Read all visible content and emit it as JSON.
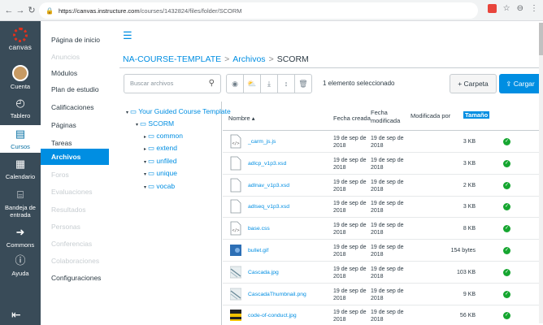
{
  "browser": {
    "url_host": "https://canvas.instructure.com",
    "url_path": "/courses/1432824/files/folder/SCORM"
  },
  "global_nav": {
    "logo": "canvas",
    "items": [
      {
        "label": "Cuenta",
        "icon": "user-avatar"
      },
      {
        "label": "Tablero",
        "icon": "dashboard-icon"
      },
      {
        "label": "Cursos",
        "icon": "courses-icon"
      },
      {
        "label": "Calendario",
        "icon": "calendar-icon"
      },
      {
        "label": "Bandeja de entrada",
        "icon": "inbox-icon"
      },
      {
        "label": "Commons",
        "icon": "commons-icon"
      },
      {
        "label": "Ayuda",
        "icon": "help-icon"
      }
    ]
  },
  "course_nav": [
    {
      "label": "Página de inicio",
      "state": "normal"
    },
    {
      "label": "Anuncios",
      "state": "disabled"
    },
    {
      "label": "Módulos",
      "state": "normal"
    },
    {
      "label": "Plan de estudio",
      "state": "normal"
    },
    {
      "label": "Calificaciones",
      "state": "normal"
    },
    {
      "label": "Páginas",
      "state": "normal"
    },
    {
      "label": "Tareas",
      "state": "normal"
    },
    {
      "label": "Archivos",
      "state": "active"
    },
    {
      "label": "Foros",
      "state": "disabled"
    },
    {
      "label": "Evaluaciones",
      "state": "disabled"
    },
    {
      "label": "Resultados",
      "state": "disabled"
    },
    {
      "label": "Personas",
      "state": "disabled"
    },
    {
      "label": "Conferencias",
      "state": "disabled"
    },
    {
      "label": "Colaboraciones",
      "state": "disabled"
    },
    {
      "label": "Configuraciones",
      "state": "normal"
    }
  ],
  "breadcrumb": {
    "course": "NA-COURSE-TEMPLATE",
    "section": "Archivos",
    "current": "SCORM",
    "separator": ">"
  },
  "toolbar": {
    "search_placeholder": "Buscar archivos",
    "selected_text": "1 elemento seleccionado",
    "folder_button": "Carpeta",
    "upload_button": "Cargar"
  },
  "tree": [
    {
      "label": "Your Guided Course Template",
      "level": 0,
      "expanded": true
    },
    {
      "label": "SCORM",
      "level": 1,
      "expanded": true
    },
    {
      "label": "common",
      "level": 2,
      "expanded": false
    },
    {
      "label": "extend",
      "level": 2,
      "expanded": false
    },
    {
      "label": "unfiled",
      "level": 2,
      "expanded": true
    },
    {
      "label": "unique",
      "level": 2,
      "expanded": true
    },
    {
      "label": "vocab",
      "level": 2,
      "expanded": true
    }
  ],
  "table": {
    "headers": {
      "name": "Nombre",
      "created": "Fecha creada",
      "modified_l1": "Fecha",
      "modified_l2": "modificada",
      "modified_by": "Modificada por",
      "size": "Tamaño"
    },
    "rows": [
      {
        "name": "_carm_js.js",
        "icon": "code",
        "created_l1": "19 de sep de",
        "created_l2": "2018",
        "modified_l1": "19 de sep de",
        "modified_l2": "2018",
        "size": "3 KB"
      },
      {
        "name": "adlcp_v1p3.xsd",
        "icon": "doc",
        "created_l1": "19 de sep de",
        "created_l2": "2018",
        "modified_l1": "19 de sep de",
        "modified_l2": "2018",
        "size": "3 KB"
      },
      {
        "name": "adlnav_v1p3.xsd",
        "icon": "doc",
        "created_l1": "19 de sep de",
        "created_l2": "2018",
        "modified_l1": "19 de sep de",
        "modified_l2": "2018",
        "size": "2 KB"
      },
      {
        "name": "adlseq_v1p3.xsd",
        "icon": "doc",
        "created_l1": "19 de sep de",
        "created_l2": "2018",
        "modified_l1": "19 de sep de",
        "modified_l2": "2018",
        "size": "3 KB"
      },
      {
        "name": "base.css",
        "icon": "code",
        "created_l1": "19 de sep de",
        "created_l2": "2018",
        "modified_l1": "19 de sep de",
        "modified_l2": "2018",
        "size": "8 KB"
      },
      {
        "name": "bullet.gif",
        "icon": "img-blue",
        "created_l1": "19 de sep de",
        "created_l2": "2018",
        "modified_l1": "19 de sep de",
        "modified_l2": "2018",
        "size": "154 bytes"
      },
      {
        "name": "Cascada.jpg",
        "icon": "img-thumb",
        "created_l1": "19 de sep de",
        "created_l2": "2018",
        "modified_l1": "19 de sep de",
        "modified_l2": "2018",
        "size": "103 KB"
      },
      {
        "name": "CascadaThumbnail.png",
        "icon": "img-thumb",
        "created_l1": "19 de sep de",
        "created_l2": "2018",
        "modified_l1": "19 de sep de",
        "modified_l2": "2018",
        "size": "9 KB"
      },
      {
        "name": "code-of-conduct.jpg",
        "icon": "img-yellow",
        "created_l1": "19 de sep de",
        "created_l2": "2018",
        "modified_l1": "19 de sep de",
        "modified_l2": "2018",
        "size": "56 KB"
      }
    ]
  },
  "colors": {
    "accent": "#008ee2",
    "global_nav_bg": "#394b58",
    "published": "#16a630"
  }
}
